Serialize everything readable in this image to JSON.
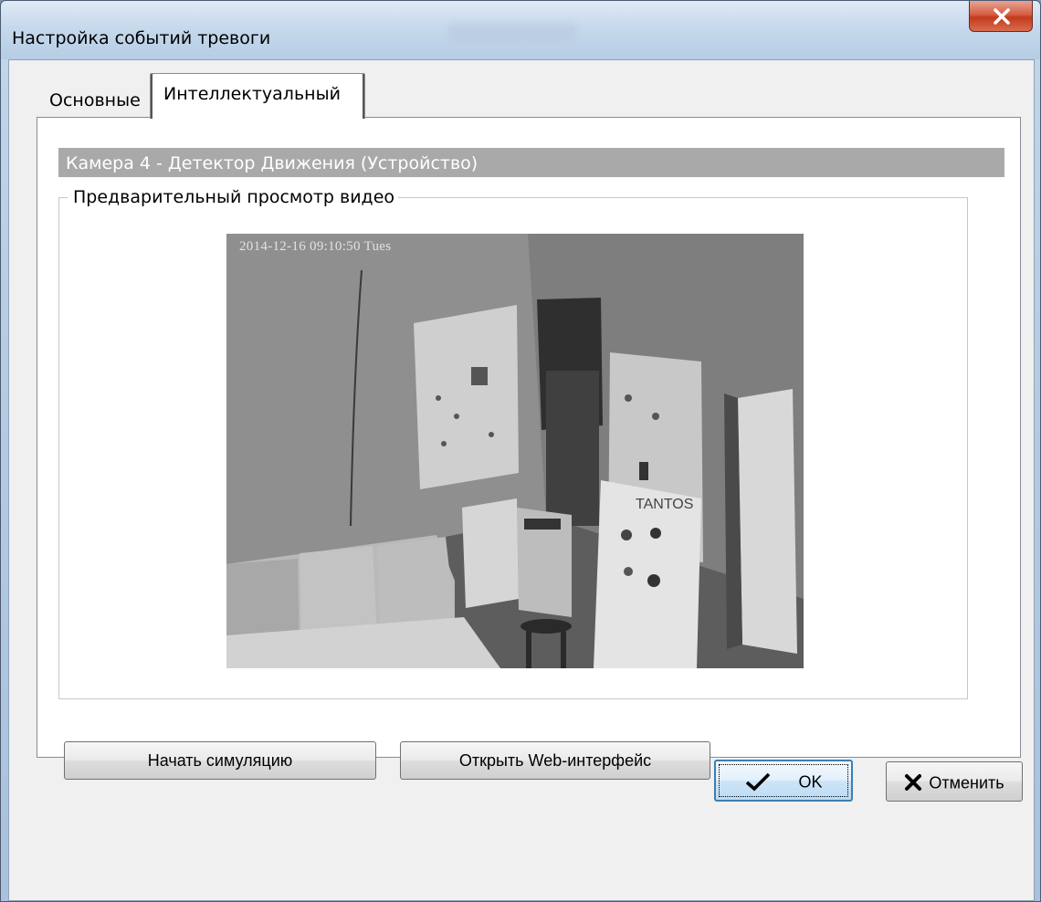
{
  "window": {
    "title": "Настройка событий тревоги",
    "close_icon": "close-icon"
  },
  "tabs": [
    {
      "label": "Основные",
      "active": false
    },
    {
      "label": "Интеллектуальный",
      "active": true
    }
  ],
  "panel": {
    "header": "Камера 4 - Детектор Движения (Устройство)",
    "group_label": "Предварительный просмотр видео",
    "video": {
      "timestamp": "2014-12-16 09:10:50 Tues",
      "brand_text": "TANTOS"
    }
  },
  "actions": {
    "simulate_label": "Начать симуляцию",
    "web_label": "Открыть Web-интерфейс"
  },
  "dialog_buttons": {
    "ok_label": "OK",
    "ok_icon": "check-icon",
    "cancel_label": "Отменить",
    "cancel_icon": "x-icon"
  },
  "colors": {
    "header_bar": "#a9a9a9",
    "close_button": "#c9432a",
    "ok_focus_border": "#3c7fb1"
  }
}
